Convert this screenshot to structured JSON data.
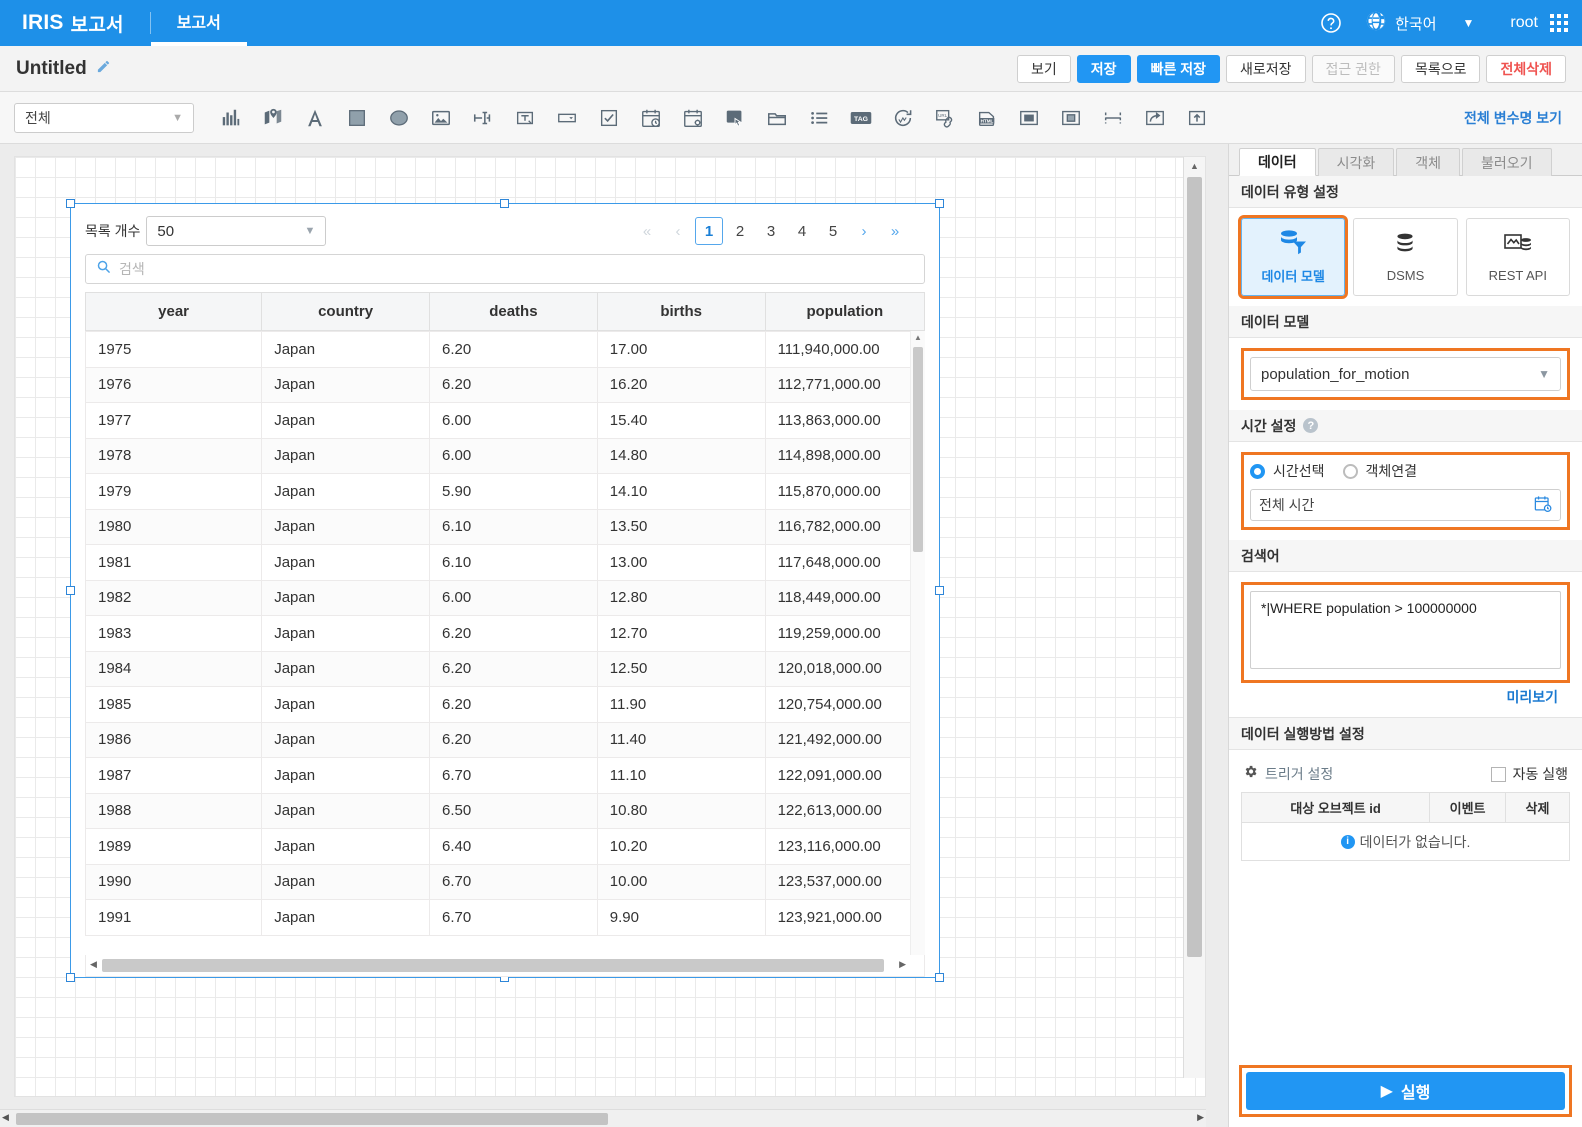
{
  "header": {
    "brand_name": "IRIS",
    "brand_sub": "보고서",
    "tab_label": "보고서",
    "help_icon": "question-circle-icon",
    "globe_icon": "globe-icon",
    "language": "한국어",
    "lang_caret": "▼",
    "user": "root",
    "apps_icon": "app-grid-icon"
  },
  "titlebar": {
    "doc_title": "Untitled",
    "edit_icon": "pencil-icon",
    "buttons": [
      {
        "label": "보기",
        "style": "default"
      },
      {
        "label": "저장",
        "style": "primary"
      },
      {
        "label": "빠른 저장",
        "style": "primary"
      },
      {
        "label": "새로저장",
        "style": "default"
      },
      {
        "label": "접근 권한",
        "style": "disabled"
      },
      {
        "label": "목록으로",
        "style": "default"
      },
      {
        "label": "전체삭제",
        "style": "danger"
      }
    ]
  },
  "toolbar": {
    "filter_value": "전체",
    "filter_caret": "▼",
    "var_link": "전체 변수명 보기",
    "icons": [
      "bar-chart-icon",
      "map-marker-icon",
      "text-letter-icon",
      "square-shape-icon",
      "ellipse-shape-icon",
      "image-icon",
      "input-field-icon",
      "textarea-icon",
      "dropdown-icon",
      "checkbox-icon",
      "datetime-picker-icon",
      "calendar-settings-icon",
      "button-click-icon",
      "panel-icon",
      "list-icon",
      "tag-icon",
      "refresh-icon",
      "url-link-icon",
      "html-icon",
      "modal-icon",
      "frame-icon",
      "divider-icon",
      "share-arrow-icon",
      "upload-icon"
    ]
  },
  "canvas": {
    "widget": {
      "list_count_label": "목록 개수",
      "list_count_value": "50",
      "list_count_caret": "▼",
      "search_icon": "search-icon",
      "search_placeholder": "검색",
      "pagination": {
        "first": "«",
        "prev": "‹",
        "pages": [
          "1",
          "2",
          "3",
          "4",
          "5"
        ],
        "active_page": "1",
        "next": "›",
        "last": "»"
      },
      "table": {
        "columns": [
          "year",
          "country",
          "deaths",
          "births",
          "population"
        ],
        "rows": [
          [
            "1975",
            "Japan",
            "6.20",
            "17.00",
            "111,940,000.00"
          ],
          [
            "1976",
            "Japan",
            "6.20",
            "16.20",
            "112,771,000.00"
          ],
          [
            "1977",
            "Japan",
            "6.00",
            "15.40",
            "113,863,000.00"
          ],
          [
            "1978",
            "Japan",
            "6.00",
            "14.80",
            "114,898,000.00"
          ],
          [
            "1979",
            "Japan",
            "5.90",
            "14.10",
            "115,870,000.00"
          ],
          [
            "1980",
            "Japan",
            "6.10",
            "13.50",
            "116,782,000.00"
          ],
          [
            "1981",
            "Japan",
            "6.10",
            "13.00",
            "117,648,000.00"
          ],
          [
            "1982",
            "Japan",
            "6.00",
            "12.80",
            "118,449,000.00"
          ],
          [
            "1983",
            "Japan",
            "6.20",
            "12.70",
            "119,259,000.00"
          ],
          [
            "1984",
            "Japan",
            "6.20",
            "12.50",
            "120,018,000.00"
          ],
          [
            "1985",
            "Japan",
            "6.20",
            "11.90",
            "120,754,000.00"
          ],
          [
            "1986",
            "Japan",
            "6.20",
            "11.40",
            "121,492,000.00"
          ],
          [
            "1987",
            "Japan",
            "6.70",
            "11.10",
            "122,091,000.00"
          ],
          [
            "1988",
            "Japan",
            "6.50",
            "10.80",
            "122,613,000.00"
          ],
          [
            "1989",
            "Japan",
            "6.40",
            "10.20",
            "123,116,000.00"
          ],
          [
            "1990",
            "Japan",
            "6.70",
            "10.00",
            "123,537,000.00"
          ],
          [
            "1991",
            "Japan",
            "6.70",
            "9.90",
            "123,921,000.00"
          ]
        ]
      }
    }
  },
  "rightpanel": {
    "tabs": [
      {
        "label": "데이터",
        "active": true
      },
      {
        "label": "시각화",
        "active": false
      },
      {
        "label": "객체",
        "active": false
      },
      {
        "label": "불러오기",
        "active": false
      }
    ],
    "datatype_section_title": "데이터 유형 설정",
    "datatype_options": [
      {
        "label": "데이터 모델",
        "icon": "database-filter-icon",
        "selected": true
      },
      {
        "label": "DSMS",
        "icon": "database-stack-icon",
        "selected": false
      },
      {
        "label": "REST API",
        "icon": "api-database-icon",
        "selected": false
      }
    ],
    "datamodel_section_title": "데이터 모델",
    "datamodel_value": "population_for_motion",
    "datamodel_caret": "▼",
    "time_section_title": "시간 설정",
    "time_help_icon": "question-circle-icon",
    "time_radio_select": "시간선택",
    "time_radio_object": "객체연결",
    "time_value": "전체 시간",
    "time_calendar_icon": "calendar-clock-icon",
    "query_section_title": "검색어",
    "query_value": "*|WHERE population > 100000000",
    "preview_link": "미리보기",
    "exec_section_title": "데이터 실행방법 설정",
    "trigger_icon": "gear-icon",
    "trigger_label": "트리거 설정",
    "auto_exec_label": "자동 실행",
    "trigger_table": {
      "columns": [
        "대상 오브젝트 id",
        "이벤트",
        "삭제"
      ],
      "empty_icon": "info-icon",
      "empty_text": "데이터가 없습니다."
    },
    "run_button": "실행",
    "run_icon": "play-icon"
  },
  "colors": {
    "brand_blue": "#1e90e8",
    "primary_blue": "#2196f3",
    "highlight_orange": "#ef7622",
    "danger_red": "#ef5350",
    "link_blue": "#1a79d0"
  }
}
